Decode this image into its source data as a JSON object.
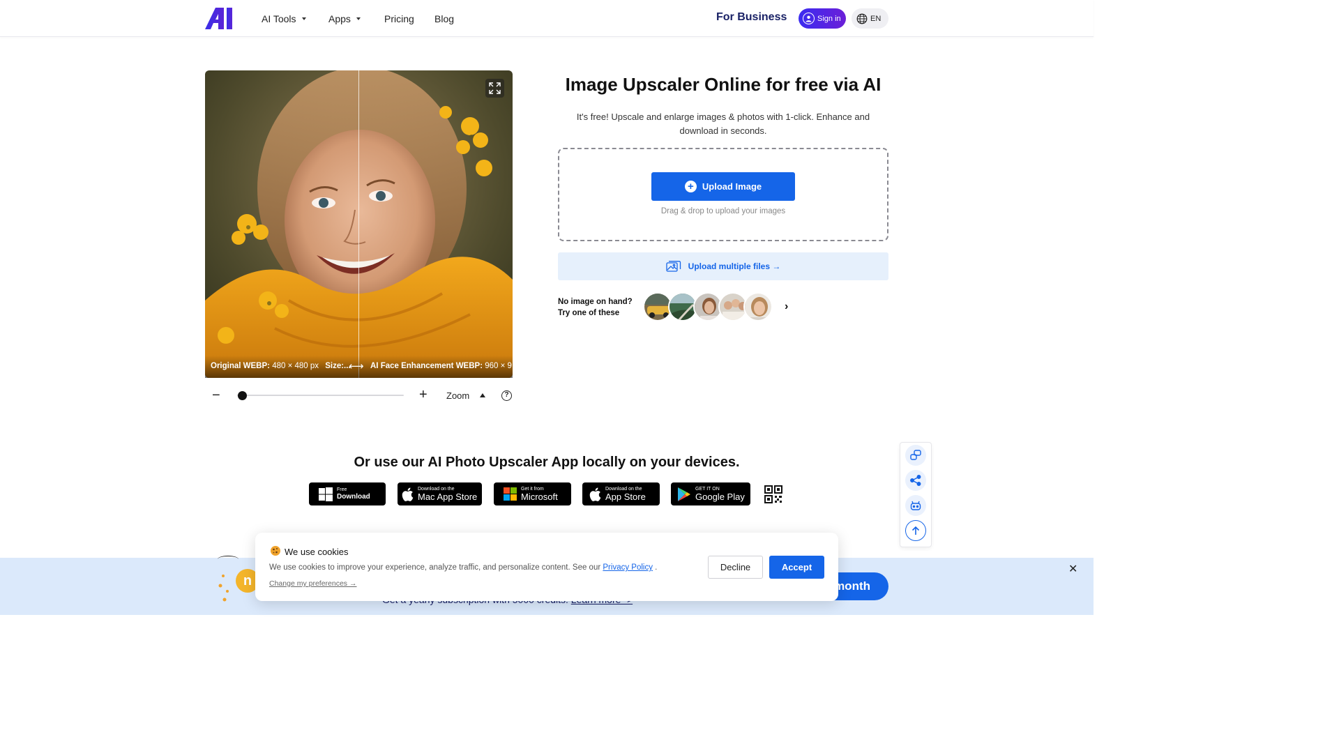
{
  "header": {
    "nav": [
      {
        "label": "AI Tools",
        "has_caret": true
      },
      {
        "label": "Apps",
        "has_caret": true
      },
      {
        "label": "Pricing",
        "has_caret": false
      },
      {
        "label": "Blog",
        "has_caret": false
      }
    ],
    "for_business": "For Business",
    "sign_in": "Sign in",
    "language": "EN"
  },
  "compare": {
    "left_caption_bold": "Original WEBP:",
    "left_caption_value": "480 × 480 px",
    "left_caption_size": "Size:...",
    "right_caption_bold": "AI Face Enhancement WEBP:",
    "right_caption_value": "960 × 9..."
  },
  "zoom": {
    "label": "Zoom",
    "level": 0.03
  },
  "hero": {
    "title": "Image Upscaler Online for free via AI",
    "subtitle": "It's free! Upscale and enlarge images & photos with 1-click. Enhance and download in seconds.",
    "upload_button": "Upload Image",
    "drag_hint": "Drag & drop to upload your images",
    "multi_upload": "Upload multiple files →",
    "no_image_line1": "No image on hand?",
    "no_image_line2": "Try one of these"
  },
  "apps": {
    "title": "Or use our AI Photo Upscaler App locally on your devices.",
    "stores": [
      {
        "small": "Free",
        "big": "Download",
        "icon": "windows-icon"
      },
      {
        "small": "Download on the",
        "big": "Mac App Store",
        "icon": "apple-icon"
      },
      {
        "small": "Get it from",
        "big": "Microsoft",
        "icon": "microsoft-icon"
      },
      {
        "small": "Download on the",
        "big": "App Store",
        "icon": "apple-icon"
      },
      {
        "small": "GET IT ON",
        "big": "Google Play",
        "icon": "google-play-icon"
      }
    ]
  },
  "promo": {
    "text": "Get a yearly subscription with 5000 credits.",
    "link": "Learn more ->",
    "button": "month"
  },
  "cookie": {
    "title": "We use cookies",
    "body": "We use cookies to improve your experience, analyze traffic, and personalize content. See our",
    "policy_link": "Privacy Policy",
    "period": ".",
    "change_prefs": "Change my preferences →",
    "decline": "Decline",
    "accept": "Accept"
  },
  "colors": {
    "primary": "#1565e8",
    "brand_navy": "#1a2266",
    "promo_bg": "#dbe9fb"
  }
}
